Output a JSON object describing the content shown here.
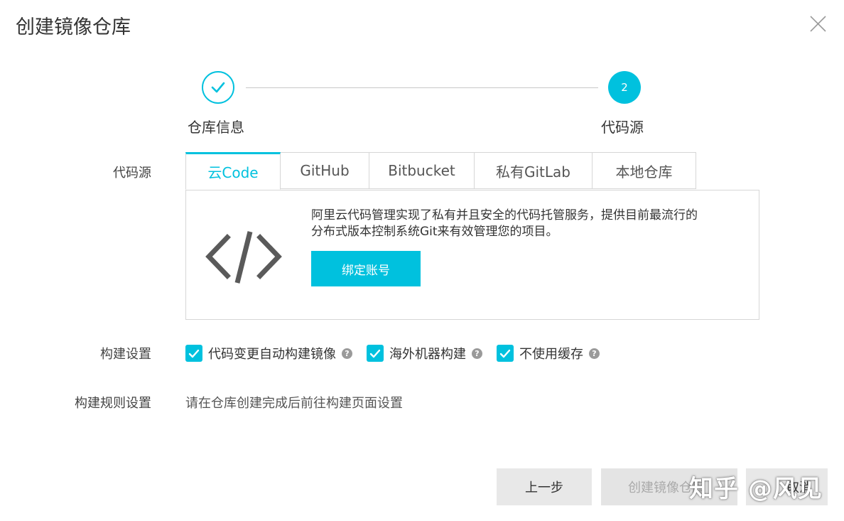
{
  "dialog": {
    "title": "创建镜像仓库",
    "close_icon": "close-icon"
  },
  "steps": [
    {
      "label": "仓库信息",
      "status": "done",
      "icon": "check-icon"
    },
    {
      "label": "代码源",
      "number": "2",
      "status": "current"
    }
  ],
  "form": {
    "source_label": "代码源",
    "build_settings_label": "构建设置",
    "build_rules_label": "构建规则设置"
  },
  "source_tabs": [
    {
      "label": "云Code",
      "active": true
    },
    {
      "label": "GitHub",
      "active": false
    },
    {
      "label": "Bitbucket",
      "active": false
    },
    {
      "label": "私有GitLab",
      "active": false
    },
    {
      "label": "本地仓库",
      "active": false
    }
  ],
  "panel": {
    "icon": "code-icon",
    "description_line1": "阿里云代码管理实现了私有并且安全的代码托管服务，提供目前最流行的",
    "description_line2": "分布式版本控制系统Git来有效管理您的项目。",
    "bind_button": "绑定账号"
  },
  "build_options": [
    {
      "label": "代码变更自动构建镜像",
      "checked": true,
      "help_icon": "question-icon"
    },
    {
      "label": "海外机器构建",
      "checked": true,
      "help_icon": "question-icon"
    },
    {
      "label": "不使用缓存",
      "checked": true,
      "help_icon": "question-icon"
    }
  ],
  "build_rules_text": "请在仓库创建完成后前往构建页面设置",
  "footer": {
    "prev_button": "上一步",
    "create_button": "创建镜像仓库",
    "cancel_button": "取消"
  },
  "watermark": "知乎 @风见",
  "colors": {
    "accent": "#00c1de",
    "border": "#d6d6d6",
    "button_gray": "#e8e8e8"
  }
}
